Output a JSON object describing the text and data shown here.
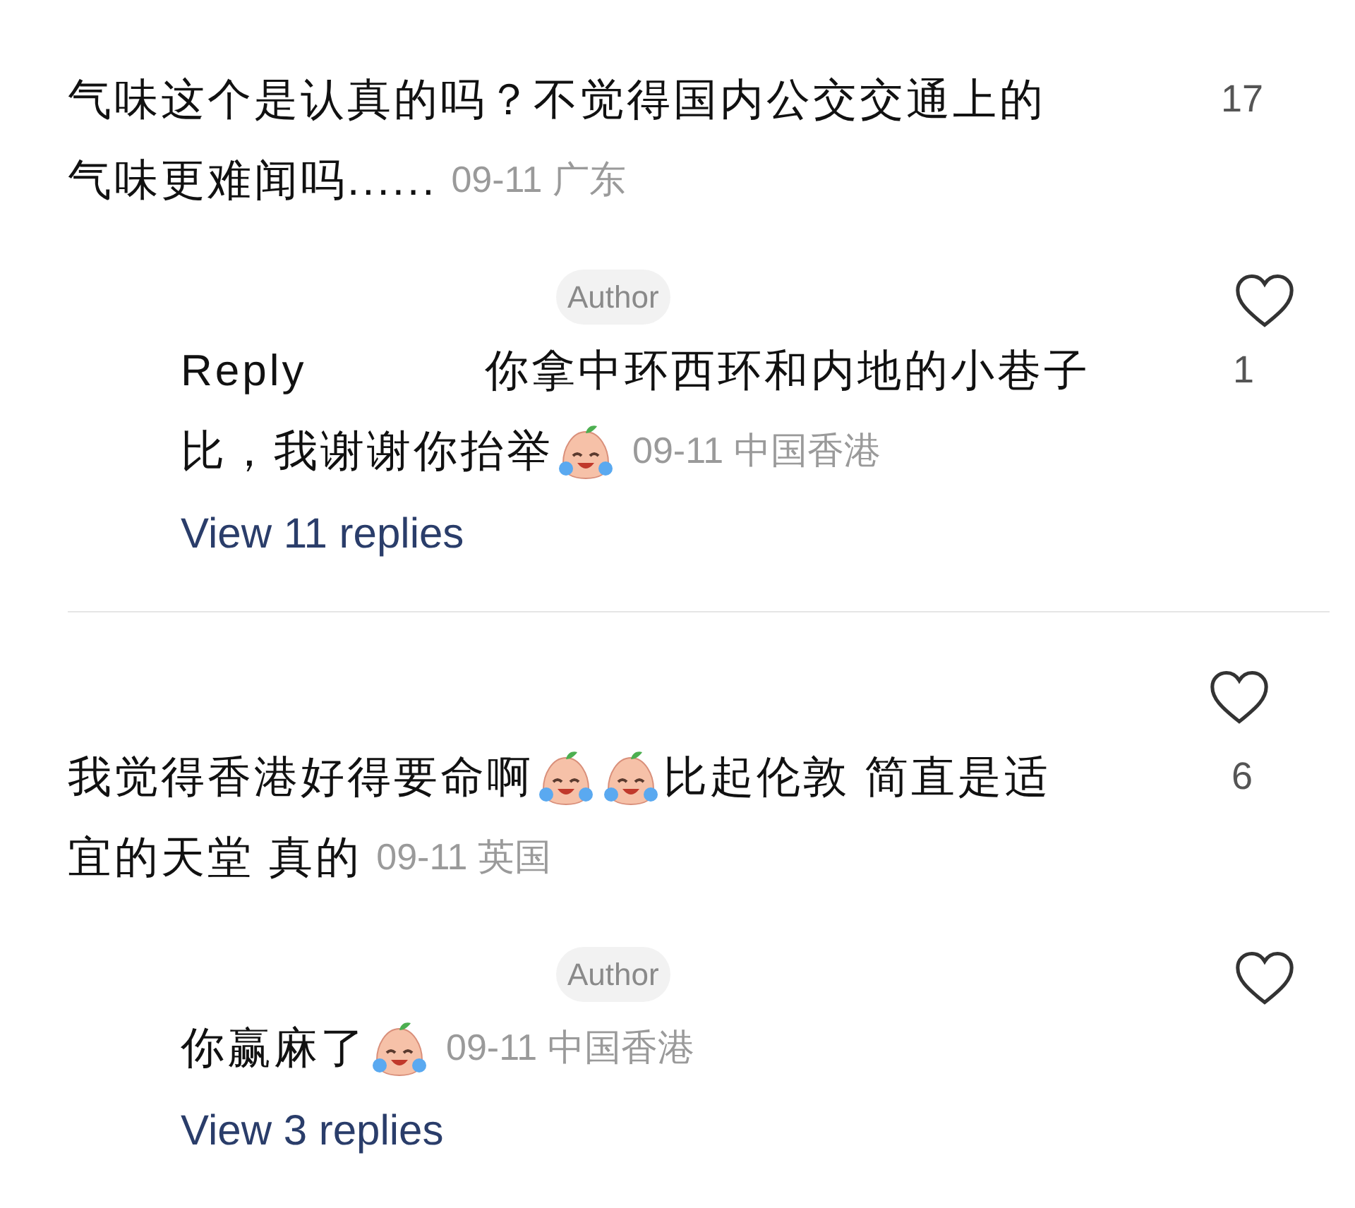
{
  "comments": [
    {
      "lines": [
        [
          {
            "kind": "text",
            "text": "气味这个是认真的吗？不觉得国内公交交通上的"
          }
        ],
        [
          {
            "kind": "text",
            "text": "气味更难闻吗......"
          }
        ]
      ],
      "meta": "09-11 广东",
      "likes": "17",
      "reply": {
        "badge": "Author",
        "liked": false,
        "prefix": "Reply",
        "lines": [
          [
            {
              "kind": "text",
              "text": "你拿中环西环和内地的小巷子"
            }
          ],
          [
            {
              "kind": "text",
              "text": "比，我谢谢你抬举"
            },
            {
              "kind": "emoji"
            }
          ]
        ],
        "meta": "09-11 中国香港",
        "likes": "1"
      },
      "view_replies": "View 11 replies"
    },
    {
      "liked": false,
      "lines": [
        [
          {
            "kind": "text",
            "text": "我觉得香港好得要命啊"
          },
          {
            "kind": "emoji"
          },
          {
            "kind": "emoji"
          },
          {
            "kind": "text",
            "text": "比起伦敦 简直是适"
          }
        ],
        [
          {
            "kind": "text",
            "text": "宜的天堂 真的"
          }
        ]
      ],
      "meta": "09-11 英国",
      "likes": "6",
      "reply": {
        "badge": "Author",
        "liked": false,
        "lines": [
          [
            {
              "kind": "text",
              "text": "你赢麻了"
            },
            {
              "kind": "emoji"
            }
          ]
        ],
        "meta": "09-11 中国香港"
      },
      "view_replies": "View 3 replies"
    }
  ]
}
